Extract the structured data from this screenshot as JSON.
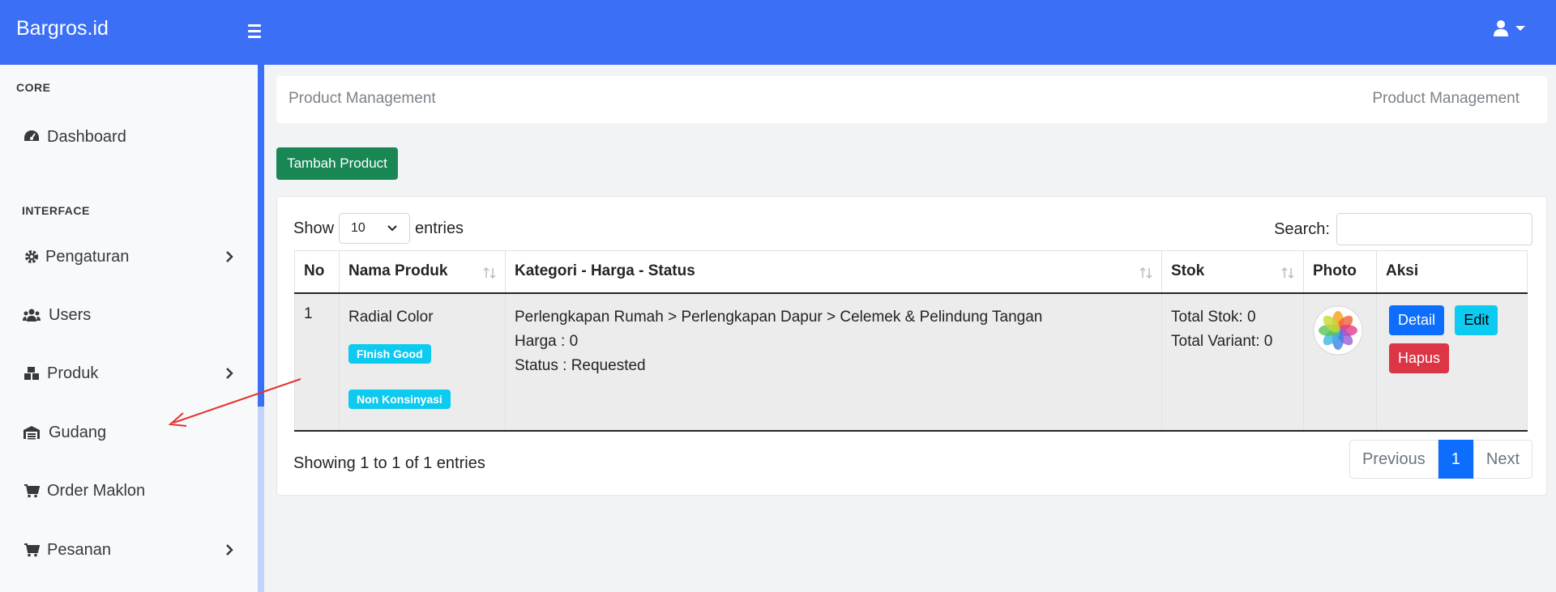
{
  "app": {
    "brand": "Bargros.id"
  },
  "colors": {
    "navbar": "#3b6ff5",
    "success": "#198754",
    "primary": "#0d6efd",
    "info": "#0dcaf0",
    "danger": "#dc3545"
  },
  "sidebar": {
    "headings": {
      "core": "CORE",
      "interface": "INTERFACE"
    },
    "items": [
      {
        "label": "Dashboard",
        "icon": "gauge-icon"
      },
      {
        "label": "Pengaturan",
        "icon": "gear-icon"
      },
      {
        "label": "Users",
        "icon": "users-icon"
      },
      {
        "label": "Produk",
        "icon": "boxes-icon"
      },
      {
        "label": "Gudang",
        "icon": "warehouse-icon"
      },
      {
        "label": "Order Maklon",
        "icon": "cart-icon"
      },
      {
        "label": "Pesanan",
        "icon": "cart-icon"
      }
    ]
  },
  "breadcrumb": {
    "left": "Product Management",
    "right": "Product Management"
  },
  "toolbar": {
    "add_label": "Tambah Product"
  },
  "table_controls": {
    "show_label": "Show",
    "page_size": "10",
    "entries_label": "entries",
    "search_label": "Search:"
  },
  "table": {
    "headers": [
      "No",
      "Nama Produk",
      "Kategori - Harga - Status",
      "Stok",
      "Photo",
      "Aksi"
    ],
    "rows": [
      {
        "no": "1",
        "name": "Radial Color",
        "badges": [
          "FInish Good",
          "Non Konsinyasi"
        ],
        "category": "Perlengkapan Rumah > Perlengkapan Dapur > Celemek & Pelindung Tangan",
        "price": "Harga : 0",
        "status": "Status : Requested",
        "total_stock": "Total Stok: 0",
        "total_variant": "Total Variant: 0",
        "photo_icon": "photos-app-icon",
        "actions": {
          "detail": "Detail",
          "edit": "Edit",
          "delete": "Hapus"
        }
      }
    ]
  },
  "footer": {
    "info": "Showing 1 to 1 of 1 entries",
    "prev": "Previous",
    "page": "1",
    "next": "Next"
  }
}
